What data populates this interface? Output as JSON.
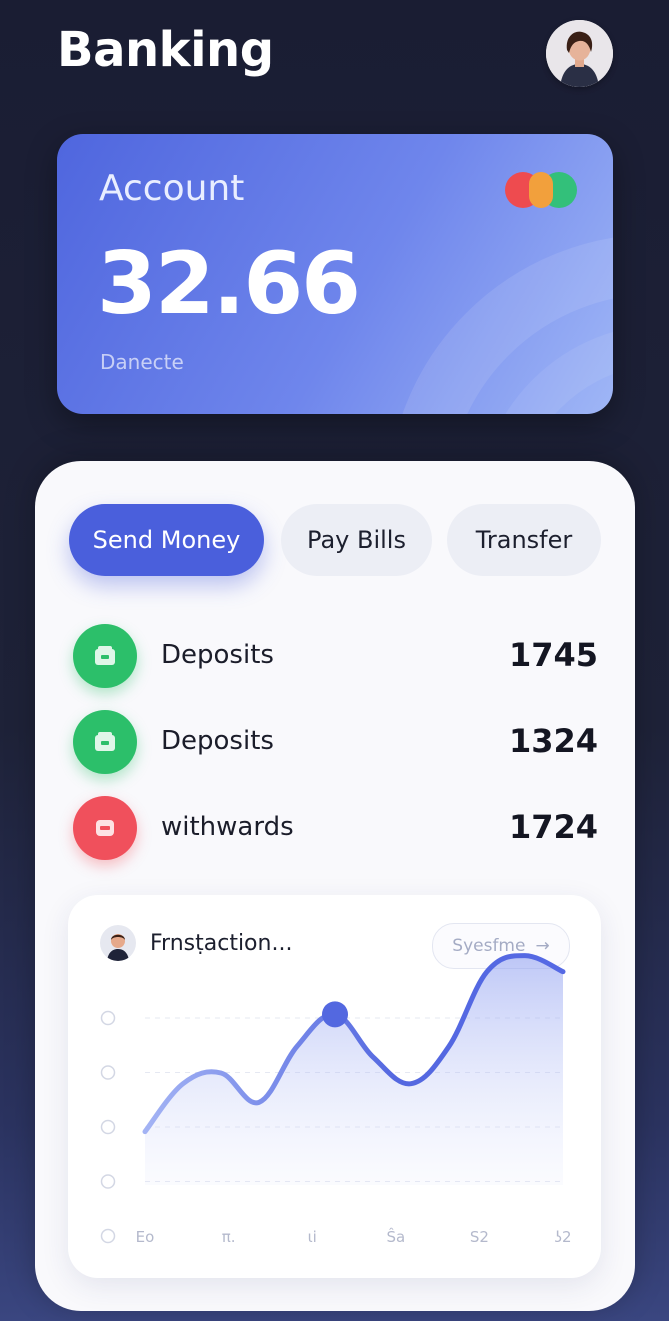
{
  "header": {
    "title": "Banking"
  },
  "card": {
    "label": "Account",
    "value": "32.66",
    "sub": "Danecte"
  },
  "actions": [
    {
      "label": "Send Money"
    },
    {
      "label": "Pay Bills"
    },
    {
      "label": "Transfer"
    }
  ],
  "transactions": [
    {
      "label": "Deposits",
      "amount": "1745",
      "icon": "wallet-icon"
    },
    {
      "label": "Deposits",
      "amount": "1324",
      "icon": "wallet-icon"
    },
    {
      "label": "withwards",
      "amount": "1724",
      "icon": "card-icon"
    }
  ],
  "colors": {
    "accent": "#4a5fdc",
    "deposit": "#2cbf6a",
    "withdraw": "#f0505c",
    "card_start": "#4f66de",
    "card_end": "#9fb6f6"
  },
  "chart_panel": {
    "title": "Frnsṭaction...",
    "button": "Syesfme",
    "button_icon": "arrow-right-icon"
  },
  "chart_data": {
    "type": "area",
    "x": [
      0,
      1,
      2,
      3,
      4,
      5,
      6,
      7,
      8,
      9,
      10,
      11
    ],
    "y": [
      1.0,
      1.9,
      2.1,
      1.55,
      2.6,
      3.2,
      2.4,
      1.9,
      2.6,
      4.0,
      4.3,
      4.0
    ],
    "tick_labels": [
      "Eo",
      "π.",
      "ɩi",
      "Ŝa",
      "S2",
      "ʖ2"
    ],
    "ylim": [
      0,
      4.5
    ],
    "grid": true,
    "highlight_index": 5
  }
}
